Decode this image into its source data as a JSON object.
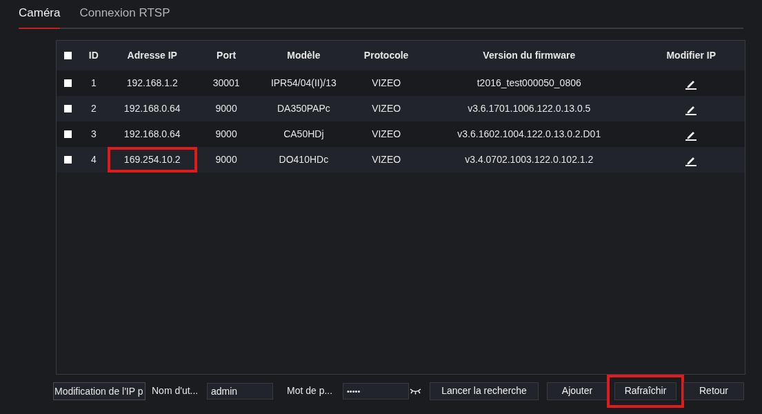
{
  "tabs": [
    {
      "label": "Caméra",
      "selected": true
    },
    {
      "label": "Connexion RTSP",
      "selected": false
    }
  ],
  "table": {
    "select_all_checked": false,
    "columns": [
      "ID",
      "Adresse IP",
      "Port",
      "Modèle",
      "Protocole",
      "Version du firmware",
      "Modifier IP"
    ],
    "rows": [
      {
        "checked": false,
        "id": "1",
        "ip": "192.168.1.2",
        "ip_highlighted": false,
        "port": "30001",
        "model": "IPR54/04(II)/13",
        "protocol": "VIZEO",
        "firmware": "t2016_test000050_0806"
      },
      {
        "checked": false,
        "id": "2",
        "ip": "192.168.0.64",
        "ip_highlighted": false,
        "port": "9000",
        "model": "DA350PAPc",
        "protocol": "VIZEO",
        "firmware": "v3.6.1701.1006.122.0.13.0.5"
      },
      {
        "checked": false,
        "id": "3",
        "ip": "192.168.0.64",
        "ip_highlighted": false,
        "port": "9000",
        "model": "CA50HDj",
        "protocol": "VIZEO",
        "firmware": "v3.6.1602.1004.122.0.13.0.2.D01"
      },
      {
        "checked": false,
        "id": "4",
        "ip": "169.254.10.2",
        "ip_highlighted": true,
        "port": "9000",
        "model": "DO410HDc",
        "protocol": "VIZEO",
        "firmware": "v3.4.0702.1003.122.0.102.1.2"
      }
    ]
  },
  "footer": {
    "mode_select": "Modification de l'IP p",
    "username_label": "Nom d'ut...",
    "username": "admin",
    "password_label": "Mot de p...",
    "password": "•••••",
    "buttons": [
      {
        "label": "Lancer la recherche",
        "highlighted": false
      },
      {
        "label": "Ajouter",
        "highlighted": false
      },
      {
        "label": "Rafraîchir",
        "highlighted": true
      },
      {
        "label": "Retour",
        "highlighted": false
      }
    ]
  }
}
